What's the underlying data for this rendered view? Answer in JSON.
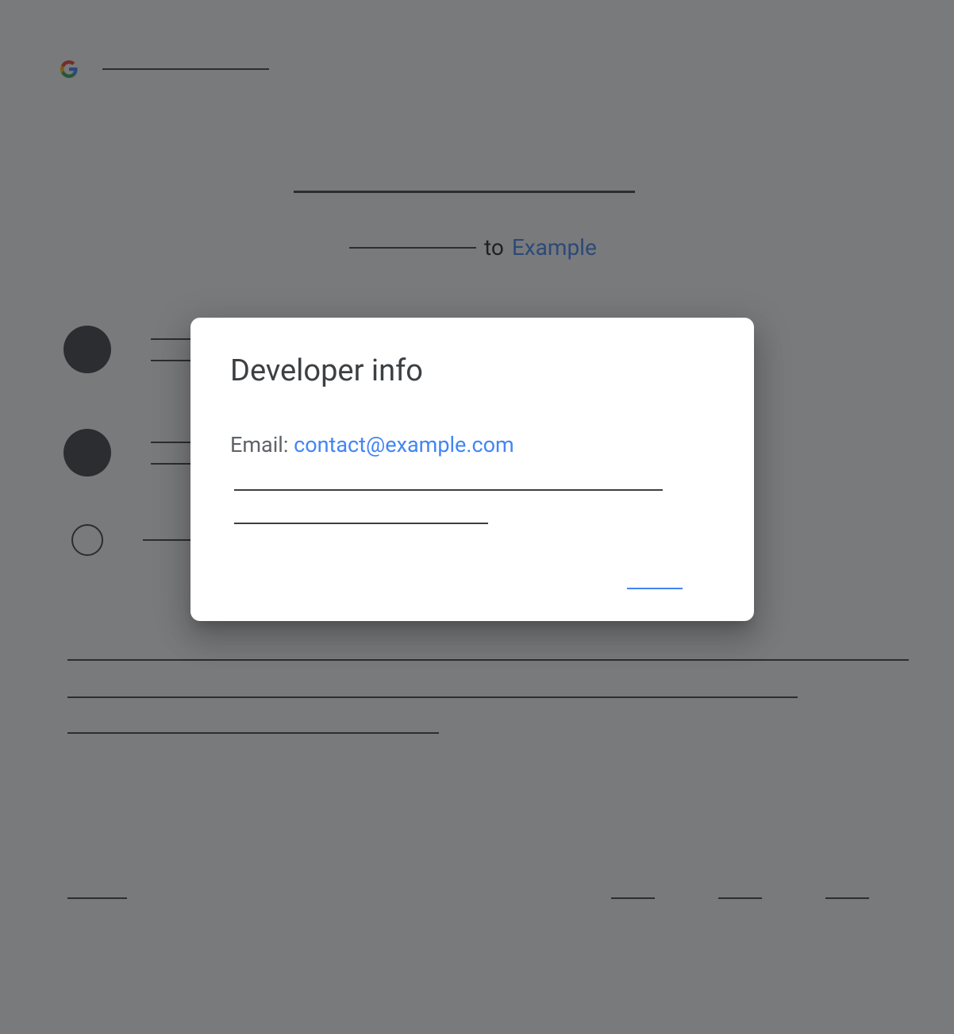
{
  "header": {
    "logo_name": "google-logo"
  },
  "subtitle": {
    "to": "to",
    "app_name": "Example"
  },
  "modal": {
    "title": "Developer info",
    "email_label": "Email: ",
    "email_value": "contact@example.com"
  }
}
